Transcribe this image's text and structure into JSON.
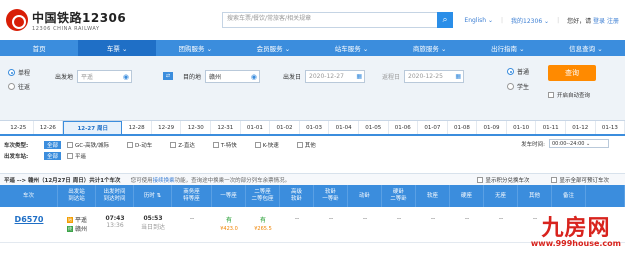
{
  "header": {
    "brand_cn": "中国铁路12306",
    "brand_en": "12306 CHINA RAILWAY",
    "search_placeholder": "搜索车票/餐饮/常旅客/相关规章",
    "lang": "English ⌄",
    "my": "我的12306 ⌄",
    "greeting": "您好，请",
    "login": "登录",
    "register": "注册"
  },
  "nav": [
    {
      "label": "首页",
      "active": false
    },
    {
      "label": "车票 ⌄",
      "active": true
    },
    {
      "label": "团购服务 ⌄",
      "active": false
    },
    {
      "label": "会员服务 ⌄",
      "active": false
    },
    {
      "label": "站车服务 ⌄",
      "active": false
    },
    {
      "label": "商旅服务 ⌄",
      "active": false
    },
    {
      "label": "出行指南 ⌄",
      "active": false
    },
    {
      "label": "信息查询 ⌄",
      "active": false
    }
  ],
  "query": {
    "trip_oneway": "单程",
    "trip_return": "往返",
    "from_label": "出发地",
    "from_value": "平遥",
    "to_label": "目的地",
    "to_value": "赣州",
    "depart_label": "出发日",
    "depart_value": "2020-12-27",
    "return_label": "返程日",
    "return_value": "2020-12-25",
    "ticket_normal": "普通",
    "ticket_student": "学生",
    "query_button": "查询",
    "auto_query": "开启自动查询"
  },
  "date_tabs": [
    "12-25",
    "12-26",
    "12-27 周日",
    "12-28",
    "12-29",
    "12-30",
    "12-31",
    "01-01",
    "01-02",
    "01-03",
    "01-04",
    "01-05",
    "01-06",
    "01-07",
    "01-08",
    "01-09",
    "01-10",
    "01-11",
    "01-12",
    "01-13"
  ],
  "filters": {
    "type_label": "车次类型:",
    "all": "全部",
    "types": [
      "GC-高铁/城际",
      "D-动车",
      "Z-直达",
      "T-特快",
      "K-快速",
      "其他"
    ],
    "from_label": "出发车站:",
    "from_station": "平遥",
    "dep_time_label": "发车时间:",
    "dep_time_value": "00:00--24:00 ⌄"
  },
  "summary": {
    "route": "平遥 --> 赣州（12月27日 周日）共计1个车次",
    "notice_pre": "您可使用",
    "notice_link": "接续换乘",
    "notice_post": "功能，查询途中换乘一次的部分列车余票情况。",
    "opt1": "显示积分兑换车次",
    "opt2": "显示全部可预订车次"
  },
  "columns": [
    "车次",
    "出发站\n到达站",
    "出发时间\n到达时间",
    "历时 ⇅",
    "商务座\n特等座",
    "一等座",
    "二等座\n二等包座",
    "高级\n软卧",
    "软卧\n一等卧",
    "动卧",
    "硬卧\n二等卧",
    "软座",
    "硬座",
    "无座",
    "其他",
    "备注"
  ],
  "rows": [
    {
      "train": "D6570",
      "from": "平遥",
      "to": "赣州",
      "dep": "07:43",
      "arr": "13:36",
      "duration": "05:53",
      "arrive_day": "当日到达",
      "business": "--",
      "first": "有",
      "first_price": "¥423.0",
      "second": "有",
      "second_price": "¥265.5",
      "g_soft": "--",
      "soft": "--",
      "move": "--",
      "hard": "--",
      "soft_seat": "--",
      "hard_seat": "--",
      "none": "--",
      "other": "--"
    }
  ],
  "watermark": {
    "title": "九房网",
    "url": "www.999house.com"
  }
}
